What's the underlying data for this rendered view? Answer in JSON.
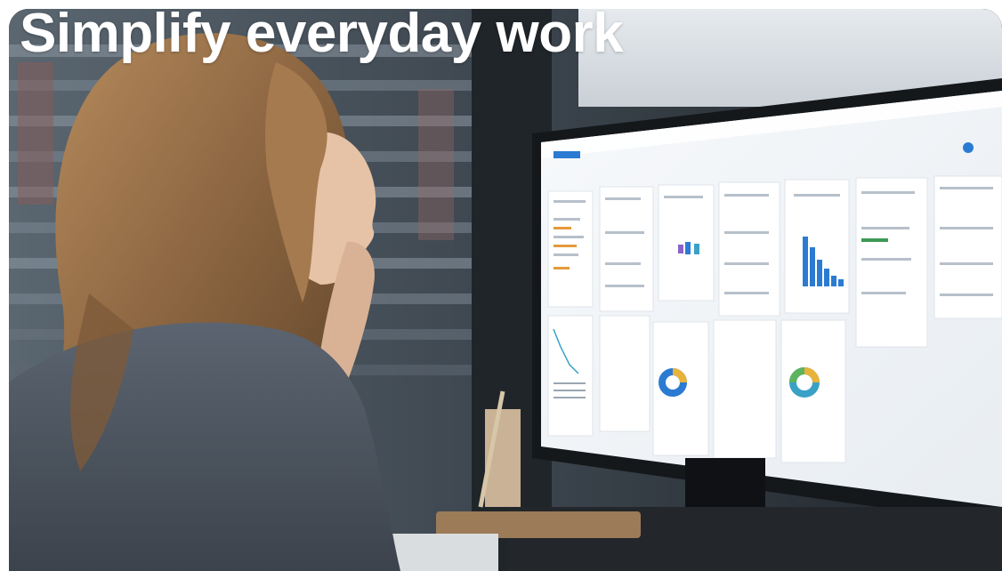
{
  "card": {
    "headline": "Simplify everyday work",
    "image_description_icon": "person-at-monitor-photo"
  },
  "colors": {
    "headline_text": "#ffffff",
    "page_background": "#ffffff",
    "screen_background": "#f3f5f8",
    "accent_blue": "#2b7bd3"
  }
}
